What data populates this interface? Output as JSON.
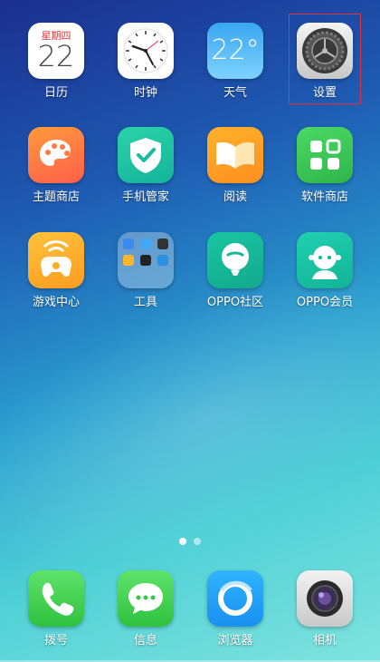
{
  "home": {
    "row1": [
      {
        "label": "日历",
        "icon": "calendar-icon",
        "weekday": "星期四",
        "day": "22"
      },
      {
        "label": "时钟",
        "icon": "clock-icon"
      },
      {
        "label": "天气",
        "icon": "weather-icon",
        "temp": "22°"
      },
      {
        "label": "设置",
        "icon": "settings-gear-icon"
      }
    ],
    "row2": [
      {
        "label": "主题商店",
        "icon": "palette-icon"
      },
      {
        "label": "手机管家",
        "icon": "shield-check-icon"
      },
      {
        "label": "阅读",
        "icon": "open-book-icon"
      },
      {
        "label": "软件商店",
        "icon": "app-store-icon"
      }
    ],
    "row3": [
      {
        "label": "游戏中心",
        "icon": "gamepad-icon"
      },
      {
        "label": "工具",
        "icon": "folder-icon"
      },
      {
        "label": "OPPO社区",
        "icon": "balloon-icon"
      },
      {
        "label": "OPPO会员",
        "icon": "member-icon"
      }
    ]
  },
  "dock": [
    {
      "label": "拨号",
      "icon": "phone-icon"
    },
    {
      "label": "信息",
      "icon": "message-icon"
    },
    {
      "label": "浏览器",
      "icon": "browser-icon"
    },
    {
      "label": "相机",
      "icon": "camera-icon"
    }
  ],
  "pages": {
    "count": 2,
    "current": 1
  },
  "colors": {
    "selection": "#e2303f",
    "calendar_red": "#e0333a"
  }
}
